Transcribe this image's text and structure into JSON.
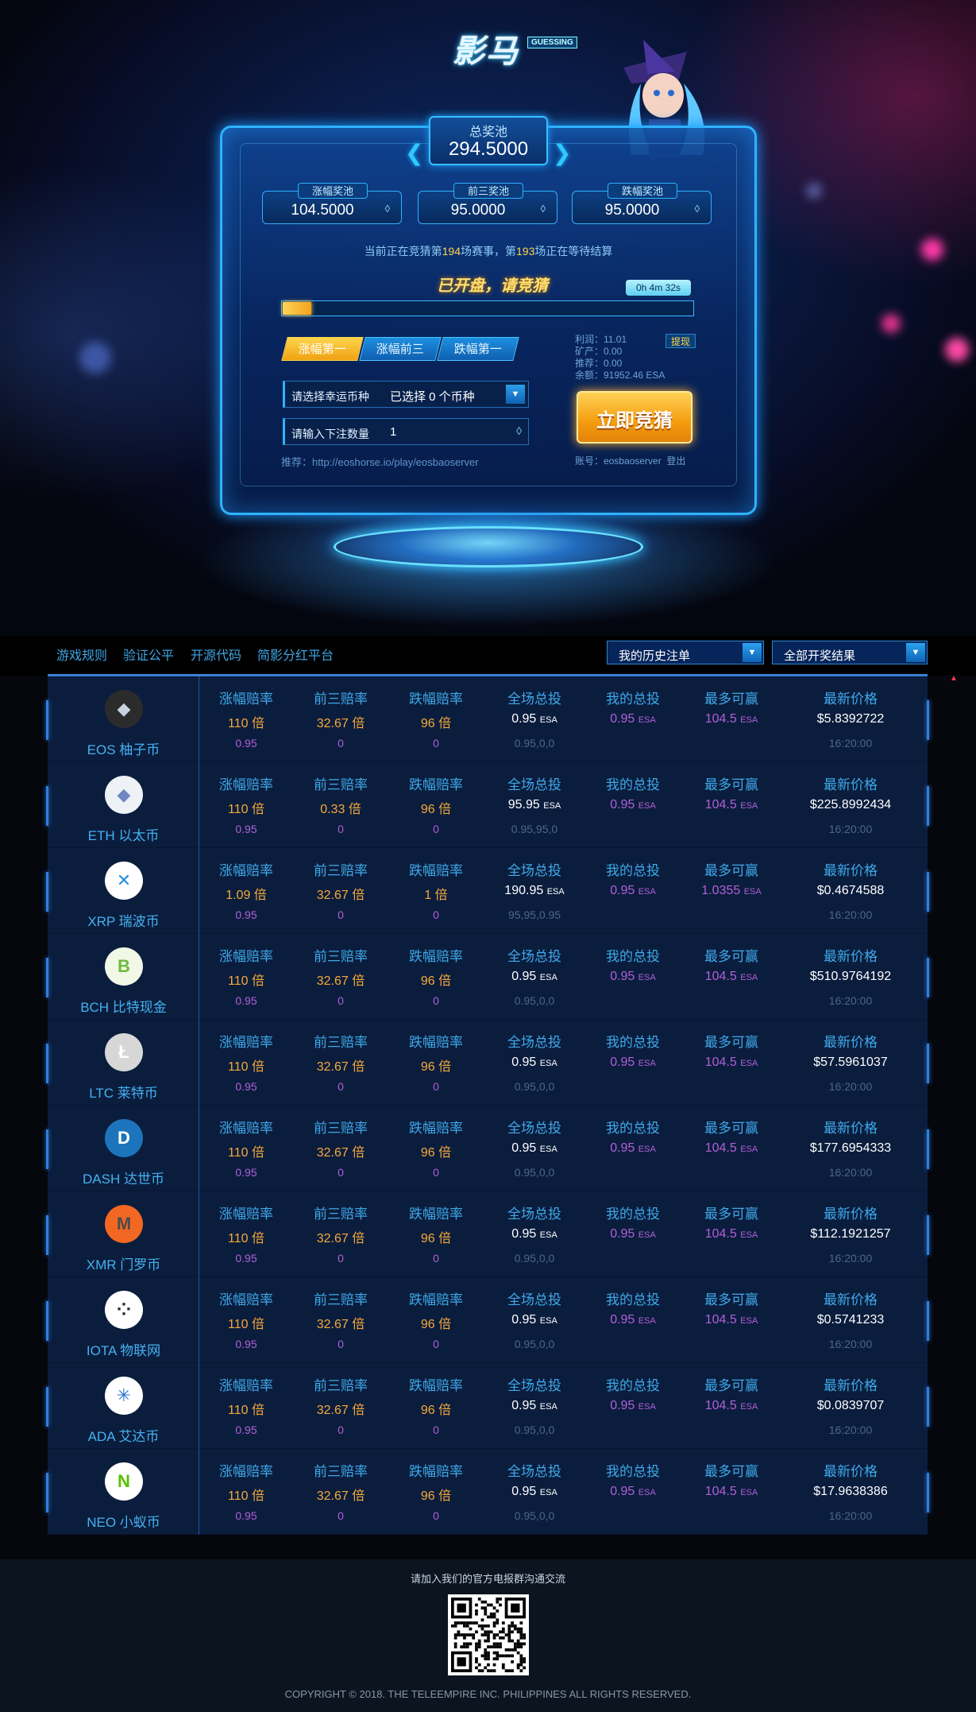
{
  "logo": {
    "text": "影马",
    "badge": "GUESSING"
  },
  "jackpot": {
    "label": "总奖池",
    "value": "294.5000"
  },
  "pools": [
    {
      "label": "涨幅奖池",
      "value": "104.5000"
    },
    {
      "label": "前三奖池",
      "value": "95.0000"
    },
    {
      "label": "跌幅奖池",
      "value": "95.0000"
    }
  ],
  "status": {
    "p1": "当前正在竞猜第",
    "game": "194",
    "p2": "场赛事，第",
    "settle": "193",
    "p3": "场正在等待结算"
  },
  "round": {
    "open_text": "已开盘，请竞猜",
    "timer": "0h 4m 32s",
    "progress": 0.07
  },
  "tabs": [
    "涨幅第一",
    "涨幅前三",
    "跌幅第一"
  ],
  "form": {
    "coin_label": "请选择幸运币种",
    "coin_value": "已选择 0 个币种",
    "amount_label": "请输入下注数量",
    "amount_value": "1",
    "ref": "推荐：http://eoshorse.io/play/eosbaoserver"
  },
  "stats": {
    "profit": "利润：11.01",
    "mining": "矿产：0.00",
    "recommend": "推荐：0.00",
    "balance": "余额：91952.46 ESA",
    "withdraw": "提现"
  },
  "bet_button": "立即竞猜",
  "account": {
    "label": "账号：eosbaoserver",
    "logout": "登出"
  },
  "nav": {
    "links": [
      "游戏规则",
      "验证公平",
      "开源代码",
      "简影分红平台"
    ],
    "history": "我的历史注单",
    "results": "全部开奖结果"
  },
  "headers": [
    "涨幅赔率",
    "前三赔率",
    "跌幅赔率",
    "全场总投",
    "我的总投",
    "最多可赢",
    "最新价格"
  ],
  "unit": "ESA",
  "coins": [
    {
      "name": "EOS 柚子币",
      "icon": "eos-icon",
      "rise": "110 倍",
      "top3": "32.67 倍",
      "fall": "96 倍",
      "total": "0.95",
      "mine": "0.95",
      "max": "104.5",
      "price": "$5.8392722",
      "rise2": "0.95",
      "top32": "0",
      "fall2": "0",
      "total2": "0.95,0,0",
      "time": "16:20:00",
      "color": "#2b2b2b",
      "glyph": "◆",
      "glyph_color": "#c9d3e0"
    },
    {
      "name": "ETH 以太币",
      "icon": "eth-icon",
      "rise": "110 倍",
      "top3": "0.33 倍",
      "fall": "96 倍",
      "total": "95.95",
      "mine": "0.95",
      "max": "104.5",
      "price": "$225.8992434",
      "rise2": "0.95",
      "top32": "0",
      "fall2": "0",
      "total2": "0.95,95,0",
      "time": "16:20:00",
      "color": "#eef2f7",
      "glyph": "◆",
      "glyph_color": "#6f86c3"
    },
    {
      "name": "XRP 瑞波币",
      "icon": "xrp-icon",
      "rise": "1.09 倍",
      "top3": "32.67 倍",
      "fall": "1 倍",
      "total": "190.95",
      "mine": "0.95",
      "max": "1.0355",
      "price": "$0.4674588",
      "rise2": "0.95",
      "top32": "0",
      "fall2": "0",
      "total2": "95,95,0.95",
      "time": "16:20:00",
      "color": "#ffffff",
      "glyph": "✕",
      "glyph_color": "#2690d8"
    },
    {
      "name": "BCH 比特现金",
      "icon": "bch-icon",
      "rise": "110 倍",
      "top3": "32.67 倍",
      "fall": "96 倍",
      "total": "0.95",
      "mine": "0.95",
      "max": "104.5",
      "price": "$510.9764192",
      "rise2": "0.95",
      "top32": "0",
      "fall2": "0",
      "total2": "0.95,0,0",
      "time": "16:20:00",
      "color": "#f1f8e5",
      "glyph": "B",
      "glyph_color": "#6dbb3f"
    },
    {
      "name": "LTC 莱特币",
      "icon": "ltc-icon",
      "rise": "110 倍",
      "top3": "32.67 倍",
      "fall": "96 倍",
      "total": "0.95",
      "mine": "0.95",
      "max": "104.5",
      "price": "$57.5961037",
      "rise2": "0.95",
      "top32": "0",
      "fall2": "0",
      "total2": "0.95,0,0",
      "time": "16:20:00",
      "color": "#d7d7d7",
      "glyph": "Ł",
      "glyph_color": "#ffffff"
    },
    {
      "name": "DASH 达世币",
      "icon": "dash-icon",
      "rise": "110 倍",
      "top3": "32.67 倍",
      "fall": "96 倍",
      "total": "0.95",
      "mine": "0.95",
      "max": "104.5",
      "price": "$177.6954333",
      "rise2": "0.95",
      "top32": "0",
      "fall2": "0",
      "total2": "0.95,0,0",
      "time": "16:20:00",
      "color": "#1c75bc",
      "glyph": "D",
      "glyph_color": "#ffffff"
    },
    {
      "name": "XMR 门罗币",
      "icon": "xmr-icon",
      "rise": "110 倍",
      "top3": "32.67 倍",
      "fall": "96 倍",
      "total": "0.95",
      "mine": "0.95",
      "max": "104.5",
      "price": "$112.1921257",
      "rise2": "0.95",
      "top32": "0",
      "fall2": "0",
      "total2": "0.95,0,0",
      "time": "16:20:00",
      "color": "#f26822",
      "glyph": "M",
      "glyph_color": "#4c4c4c"
    },
    {
      "name": "IOTA 物联网",
      "icon": "iota-icon",
      "rise": "110 倍",
      "top3": "32.67 倍",
      "fall": "96 倍",
      "total": "0.95",
      "mine": "0.95",
      "max": "104.5",
      "price": "$0.5741233",
      "rise2": "0.95",
      "top32": "0",
      "fall2": "0",
      "total2": "0.95,0,0",
      "time": "16:20:00",
      "color": "#ffffff",
      "glyph": "⁘",
      "glyph_color": "#242424"
    },
    {
      "name": "ADA 艾达币",
      "icon": "ada-icon",
      "rise": "110 倍",
      "top3": "32.67 倍",
      "fall": "96 倍",
      "total": "0.95",
      "mine": "0.95",
      "max": "104.5",
      "price": "$0.0839707",
      "rise2": "0.95",
      "top32": "0",
      "fall2": "0",
      "total2": "0.95,0,0",
      "time": "16:20:00",
      "color": "#ffffff",
      "glyph": "✳",
      "glyph_color": "#2a71d0"
    },
    {
      "name": "NEO 小蚁币",
      "icon": "neo-icon",
      "rise": "110 倍",
      "top3": "32.67 倍",
      "fall": "96 倍",
      "total": "0.95",
      "mine": "0.95",
      "max": "104.5",
      "price": "$17.9638386",
      "rise2": "0.95",
      "top32": "0",
      "fall2": "0",
      "total2": "0.95,0,0",
      "time": "16:20:00",
      "color": "#ffffff",
      "glyph": "N",
      "glyph_color": "#58bf00"
    }
  ],
  "footer": {
    "join": "请加入我们的官方电报群沟通交流",
    "copyright": "COPYRIGHT © 2018. THE TELEEMPIRE INC. PHILIPPINES ALL RIGHTS RESERVED."
  }
}
